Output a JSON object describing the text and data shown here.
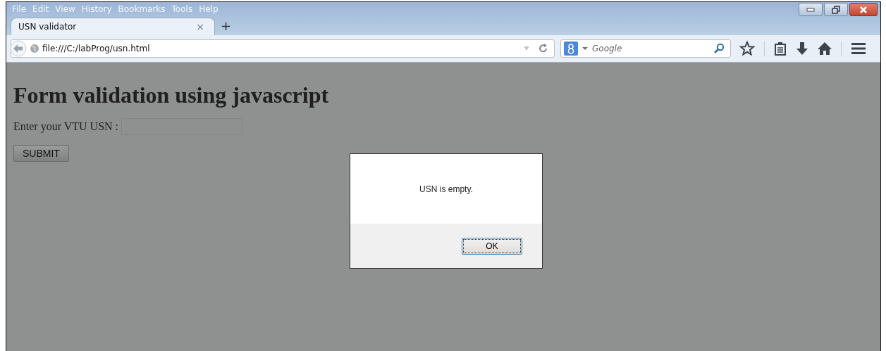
{
  "menu": [
    "File",
    "Edit",
    "View",
    "History",
    "Bookmarks",
    "Tools",
    "Help"
  ],
  "tabs": [
    {
      "label": "USN validator",
      "selected": true,
      "close": "×"
    }
  ],
  "new_tab": "+",
  "address": {
    "value": "file:///C:/labProg/usn.html"
  },
  "search": {
    "placeholder": "Google"
  },
  "page": {
    "heading": "Form validation using javascript",
    "label": "Enter your VTU USN :",
    "button": "SUBMIT"
  },
  "dialog": {
    "message": "USN is empty.",
    "button": "OK"
  }
}
